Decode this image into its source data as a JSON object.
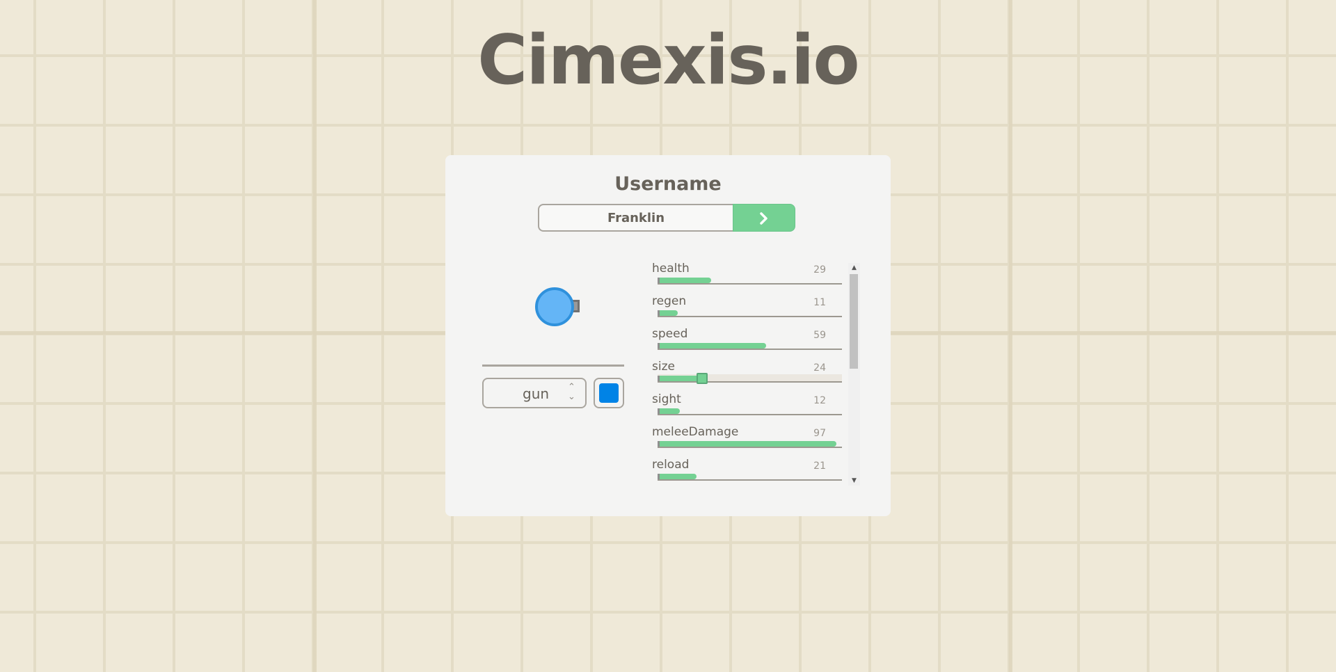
{
  "app": {
    "title": "Cimexis.io"
  },
  "form": {
    "username_label": "Username",
    "username_value": "Franklin",
    "play_icon": "chevron-right-icon"
  },
  "loadout": {
    "weapon_value": "gun",
    "color": "#0083e6",
    "tank_body_color": "#64b5f6"
  },
  "stats": [
    {
      "name": "health",
      "value": "29",
      "level": 0.29
    },
    {
      "name": "regen",
      "value": "11",
      "level": 0.11
    },
    {
      "name": "speed",
      "value": "59",
      "level": 0.59
    },
    {
      "name": "size",
      "value": "24",
      "level": 0.24
    },
    {
      "name": "sight",
      "value": "12",
      "level": 0.12
    },
    {
      "name": "meleeDamage",
      "value": "97",
      "level": 0.97
    },
    {
      "name": "reload",
      "value": "21",
      "level": 0.21
    }
  ],
  "accent_color": "#74d193"
}
